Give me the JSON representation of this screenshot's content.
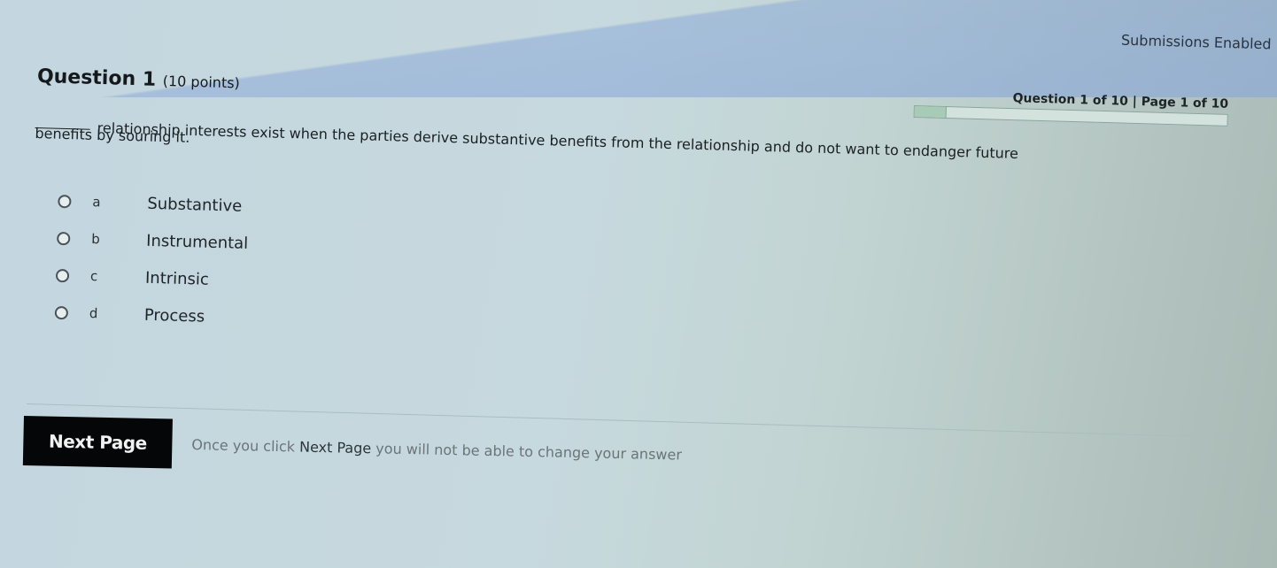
{
  "header": {
    "submissions_status": "Submissions Enabled"
  },
  "question": {
    "title": "Question 1",
    "points": "(10 points)",
    "text_line1": "relationship interests exist when the parties derive substantive benefits from the relationship and do not want to endanger future",
    "text_line2": "benefits by souring it."
  },
  "progress": {
    "label": "Question 1 of 10 | Page 1 of 10",
    "fraction": 0.1,
    "fill_color": "#a7cbb7"
  },
  "options": [
    {
      "letter": "a",
      "text": "Substantive",
      "selected": false
    },
    {
      "letter": "b",
      "text": "Instrumental",
      "selected": false
    },
    {
      "letter": "c",
      "text": "Intrinsic",
      "selected": false
    },
    {
      "letter": "d",
      "text": "Process",
      "selected": false
    }
  ],
  "footer": {
    "next_button_label": "Next Page",
    "note_prefix": "Once you click",
    "note_emphasis": "Next Page",
    "note_suffix": "you will not be able to change your answer"
  }
}
